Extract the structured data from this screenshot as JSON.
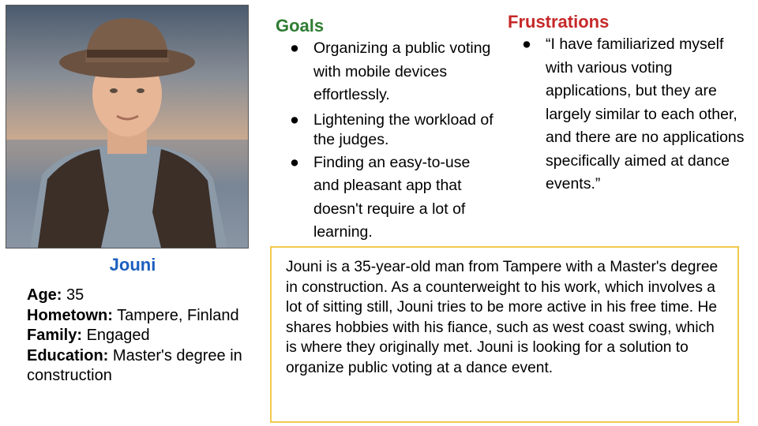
{
  "persona": {
    "photo_icon": "person-photo",
    "name": "Jouni",
    "facts": [
      {
        "label": "Age:",
        "value": "35"
      },
      {
        "label": "Hometown:",
        "value": "Tampere, Finland"
      },
      {
        "label": "Family:",
        "value": "Engaged"
      },
      {
        "label": "Education:",
        "value": "Master's degree in construction"
      }
    ]
  },
  "goals": {
    "title": "Goals",
    "items": [
      "Organizing a public voting with mobile devices effortlessly.",
      "Lightening the workload of the judges.",
      "Finding an easy-to-use and pleasant app that doesn't require a lot of learning."
    ]
  },
  "frustrations": {
    "title": "Frustrations",
    "items": [
      "“I have familiarized myself with various voting applications, but they are largely similar to each other, and there are no applications specifically aimed at dance events.”"
    ]
  },
  "bio": {
    "text": "Jouni is a 35-year-old man from Tampere with a Master's degree in construction. As a counterweight to his work, which involves a lot of sitting still, Jouni tries to be more active in his free time. He shares hobbies with his fiance, such as west coast swing, which is where they originally met. Jouni is looking for a solution to organize public voting at a dance event."
  },
  "colors": {
    "name": "#1c5fbf",
    "goals_title": "#2e7d32",
    "frustrations_title": "#c62828",
    "bio_border": "#f2c94c"
  },
  "bullet_char": "●"
}
